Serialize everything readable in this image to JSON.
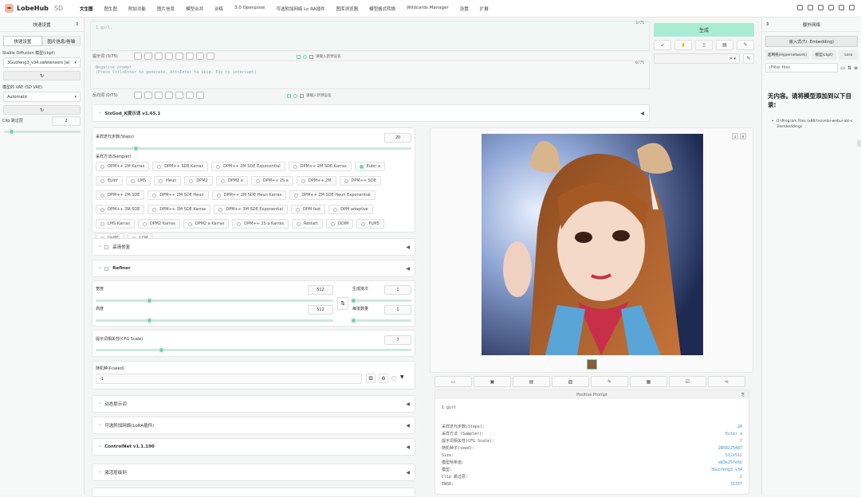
{
  "app": {
    "brand": "LobeHub",
    "sub": "SD"
  },
  "nav": [
    "文生图",
    "图生图",
    "附加功能",
    "图片信息",
    "模型合并",
    "训练",
    "3.0 Openpose",
    "可选附加网络 Lo RA插件",
    "图库浏览器",
    "模型格式转换",
    "Wildcards Manager",
    "设置",
    "扩展"
  ],
  "left": {
    "header": "快速设置",
    "tab_quick": "快速设置",
    "tab_other": "图片信息/卷轴",
    "model_label": "Stable Diffusion 模型(ckpt)",
    "model_value": "3Guofeng3_v34.safetensors [a(",
    "vae_label": "模型的 VAE (SD VAE)",
    "vae_value": "Automatic",
    "clip_label": "Clip 跳过层",
    "clip_value": "2",
    "clip_level": 2,
    "refresh": "↻"
  },
  "prompt": {
    "count": "3/75",
    "text": "1 girl,",
    "label": "提示词",
    "label_count": "(3/75)",
    "style_placeholder": "请输入新预设名"
  },
  "neg": {
    "count": "0/75",
    "text": "Negative prompt\n(Press Ctrl+Enter to generate, Alt+Enter to skip, Esc to interrupt)",
    "label": "反向词",
    "label_count": "(0/75)",
    "style_placeholder": "请输入新预设名"
  },
  "sixgod": "SixGod_K提示词 v1.65.1",
  "steps": {
    "label": "采样迭代步数(Steps)",
    "value": "20",
    "level": 20
  },
  "sampler": {
    "label": "采样方法(Sampler)",
    "options": [
      "DPM++ 2M Karras",
      "DPM++ SDE Karras",
      "DPM++ 2M SDE Exponential",
      "DPM++ 2M SDE Karras",
      "Euler a",
      "Euler",
      "LMS",
      "Heun",
      "DPM2",
      "DPM2 a",
      "DPM++ 2S a",
      "DPM++ 2M",
      "DPM++ SDE",
      "DPM++ 2M SDE",
      "DPM++ 2M SDE Heun",
      "DPM++ 2M SDE Heun Karras",
      "DPM++ 2M SDE Heun Exponential",
      "DPM++ 3M SDE",
      "DPM++ 3M SDE Karras",
      "DPM++ 3M SDE Exponential",
      "DPM fast",
      "DPM adaptive",
      "LMS Karras",
      "DPM2 Karras",
      "DPM2 a Karras",
      "DPM++ 2S a Karras",
      "Restart",
      "DDIM",
      "PLMS",
      "UniPC",
      "LCM"
    ],
    "selected": "Euler a"
  },
  "hires": "高清修复",
  "refiner": "Refiner",
  "width": {
    "label": "宽度",
    "value": "512",
    "level": 512
  },
  "height": {
    "label": "高度",
    "value": "512",
    "level": 512
  },
  "batch_count": {
    "label": "生成批次",
    "value": "1"
  },
  "batch_size": {
    "label": "每批数量",
    "value": "1"
  },
  "cfg": {
    "label": "提示词相关性(CFG Scale)",
    "value": "7",
    "level": 7
  },
  "seed": {
    "label": "随机种子(seed)",
    "value": "-1"
  },
  "accordions": [
    "动态提示词",
    "可选附加网络(LoRA插件)",
    "ControlNet v1.1.190",
    "激活层级到"
  ],
  "generate": "生成",
  "output": {
    "positive_title": "Positive Prompt",
    "positive_text": "1 girl",
    "params": [
      [
        "采样迭代步数(Steps):",
        "20"
      ],
      [
        "采样方法 (Sampler):",
        "Euler a"
      ],
      [
        "提示词相关性(CFG Scale):",
        "7"
      ],
      [
        "随机种子(seed):",
        "2858225487"
      ],
      [
        "Size:",
        "512x512"
      ],
      [
        "模型哈希值:",
        "a83e25fe5b"
      ],
      [
        "模型:",
        "3Guofeng3_v34"
      ],
      [
        "Clip 跳过层:",
        "2"
      ],
      [
        "ENSD:",
        "31337"
      ]
    ]
  },
  "right": {
    "header": "额外网络",
    "tabs": [
      "嵌入式(T.I. Embedding)",
      "超网络(Hypernetwork)",
      "模型(ckpt)",
      "Lora"
    ],
    "filter": "Filter files",
    "empty_title": "无内容。请将模型添加到以下目录:",
    "path": "D:\\Program Files (x86)\\novelai-webui-aki-v3\\embeddings"
  },
  "colors": {
    "accent": "#6fd1b1",
    "generate": "#a8ecd4"
  }
}
